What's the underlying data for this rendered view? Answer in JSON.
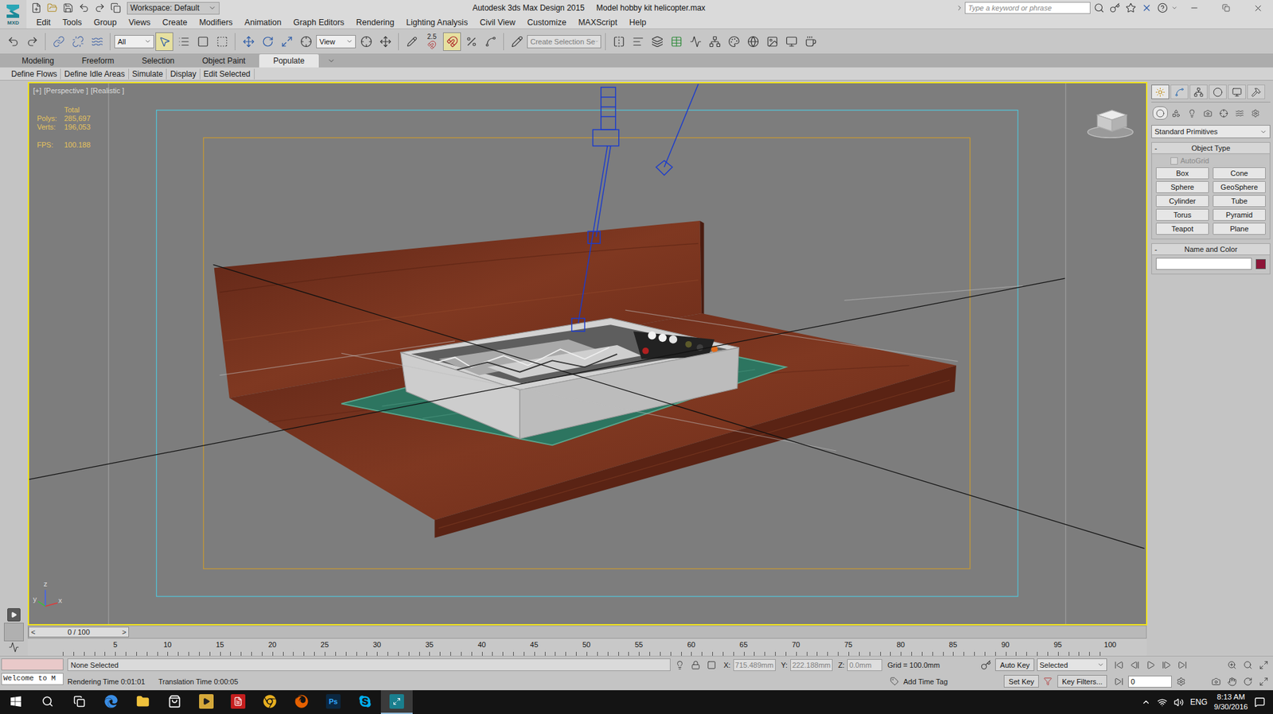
{
  "app": {
    "logo": "MXD",
    "workspace": "Workspace: Default",
    "title": "Autodesk 3ds Max Design 2015",
    "file": "Model hobby kit helicopter.max",
    "search_placeholder": "Type a keyword or phrase"
  },
  "menu": [
    "Edit",
    "Tools",
    "Group",
    "Views",
    "Create",
    "Modifiers",
    "Animation",
    "Graph Editors",
    "Rendering",
    "Lighting Analysis",
    "Civil View",
    "Customize",
    "MAXScript",
    "Help"
  ],
  "toolbar": {
    "selection_filter": "All",
    "reference_coordinate": "View",
    "snap": "2.5",
    "named_selection": "Create Selection Se"
  },
  "ribbon_tabs": [
    {
      "label": "Modeling",
      "selected": false
    },
    {
      "label": "Freeform",
      "selected": false
    },
    {
      "label": "Selection",
      "selected": false
    },
    {
      "label": "Object Paint",
      "selected": false
    },
    {
      "label": "Populate",
      "selected": true
    }
  ],
  "ribbon_tools": [
    "Define Flows",
    "Define Idle Areas",
    "Simulate",
    "Display",
    "Edit Selected"
  ],
  "viewport": {
    "active": true,
    "labels": [
      "[+]",
      "[Perspective ]",
      "[Realistic ]"
    ],
    "stats_title": "Total",
    "stats": [
      {
        "label": "Polys:",
        "value": "285,697"
      },
      {
        "label": "Verts:",
        "value": "196,053"
      },
      {
        "label": "FPS:",
        "value": "100.188"
      }
    ],
    "axes": [
      "z",
      "y",
      "x"
    ]
  },
  "command_panel": {
    "tabs": [
      {
        "selected": true
      },
      {
        "selected": false
      },
      {
        "selected": false
      },
      {
        "selected": false
      },
      {
        "selected": false
      },
      {
        "selected": false
      }
    ],
    "categories": [
      {
        "selected": true
      },
      {
        "selected": false
      },
      {
        "selected": false
      },
      {
        "selected": false
      },
      {
        "selected": false
      },
      {
        "selected": false
      },
      {
        "selected": false
      }
    ],
    "category": "Standard Primitives",
    "object_type": {
      "mark": "-",
      "title": "Object Type",
      "autogrid": {
        "label": "AutoGrid",
        "checked": false,
        "disabled": true
      },
      "buttons": [
        "Box",
        "Cone",
        "Sphere",
        "GeoSphere",
        "Cylinder",
        "Tube",
        "Torus",
        "Pyramid",
        "Teapot",
        "Plane"
      ]
    },
    "name_and_color": {
      "mark": "-",
      "title": "Name and Color",
      "name": "",
      "color": "#8e1538"
    }
  },
  "timeline": {
    "position": "0 / 100",
    "prev": "<",
    "next": ">",
    "level": 0,
    "ticks": [
      "5",
      "10",
      "15",
      "20",
      "25",
      "30",
      "35",
      "40",
      "45",
      "50",
      "55",
      "60",
      "65",
      "70",
      "75",
      "80",
      "85",
      "90",
      "95",
      "100"
    ]
  },
  "status": {
    "listener": "Welcome to M",
    "prompt": "None Selected",
    "rendering_time": "Rendering Time  0:01:01",
    "translation_time": "Translation Time  0:00:05",
    "coords": [
      {
        "label": "X:",
        "value": "715.489mm"
      },
      {
        "label": "Y:",
        "value": "222.188mm"
      },
      {
        "label": "Z:",
        "value": "0.0mm"
      }
    ],
    "grid": "Grid = 100.0mm",
    "add_time_tag": "Add Time Tag",
    "auto_key": {
      "label": "Auto Key",
      "on": false
    },
    "key_mode": "Selected",
    "set_key": "Set Key",
    "key_filters": "Key Filters...",
    "frame": "0"
  },
  "taskbar": {
    "apps": [
      {
        "kind": "edge",
        "text": "",
        "active": false
      },
      {
        "kind": "explorer",
        "text": "",
        "active": false
      },
      {
        "kind": "store",
        "text": "",
        "active": false
      },
      {
        "kind": "media",
        "text": "",
        "active": false
      },
      {
        "kind": "acrobat",
        "text": "",
        "active": false
      },
      {
        "kind": "chrome",
        "text": "",
        "active": false
      },
      {
        "kind": "firefox",
        "text": "",
        "active": false
      },
      {
        "kind": "photoshop",
        "text": "Ps",
        "active": false
      },
      {
        "kind": "skype",
        "text": "",
        "active": false
      },
      {
        "kind": "max",
        "text": "",
        "active": true
      }
    ],
    "language": "ENG",
    "time": "8:13 AM",
    "date": "9/30/2016"
  }
}
